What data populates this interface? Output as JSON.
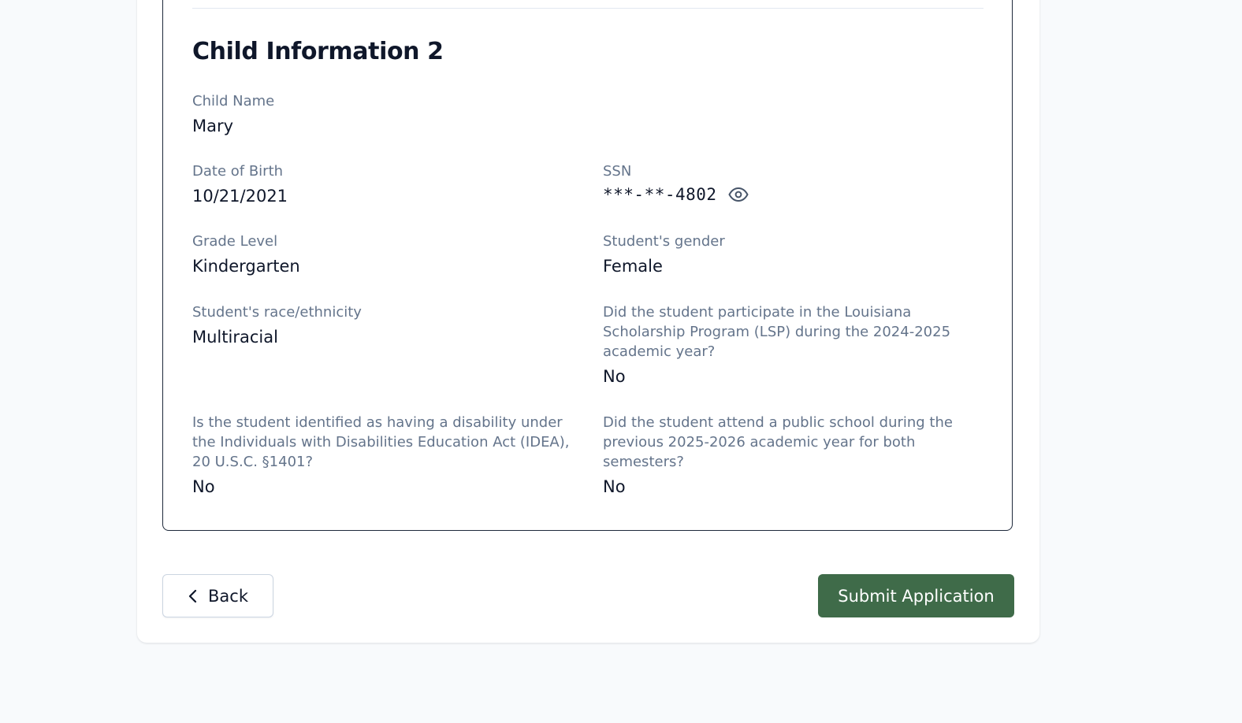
{
  "section": {
    "title": "Child Information 2"
  },
  "fields": {
    "child_name": {
      "label": "Child Name",
      "value": "Mary"
    },
    "date_of_birth": {
      "label": "Date of Birth",
      "value": "10/21/2021"
    },
    "ssn": {
      "label": "SSN",
      "value": "***-**-4802",
      "icon": "eye-icon"
    },
    "grade_level": {
      "label": "Grade Level",
      "value": "Kindergarten"
    },
    "gender": {
      "label": "Student's gender",
      "value": "Female"
    },
    "race": {
      "label": "Student's race/ethnicity",
      "value": "Multiracial"
    },
    "lsp": {
      "label": "Did the student participate in the Louisiana Scholarship Program (LSP) during the 2024-2025 academic year?",
      "value": "No"
    },
    "idea": {
      "label": "Is the student identified as having a disability under the Individuals with Disabilities Education Act (IDEA), 20 U.S.C. §1401?",
      "value": "No"
    },
    "public_school": {
      "label": "Did the student attend a public school during the previous 2025-2026 academic year for both semesters?",
      "value": "No"
    }
  },
  "actions": {
    "back_label": "Back",
    "back_icon": "chevron-left-icon",
    "submit_label": "Submit Application"
  },
  "colors": {
    "primary": "#3f6b49",
    "label": "#64748b",
    "text": "#0f172a",
    "background": "#f8fafc"
  }
}
